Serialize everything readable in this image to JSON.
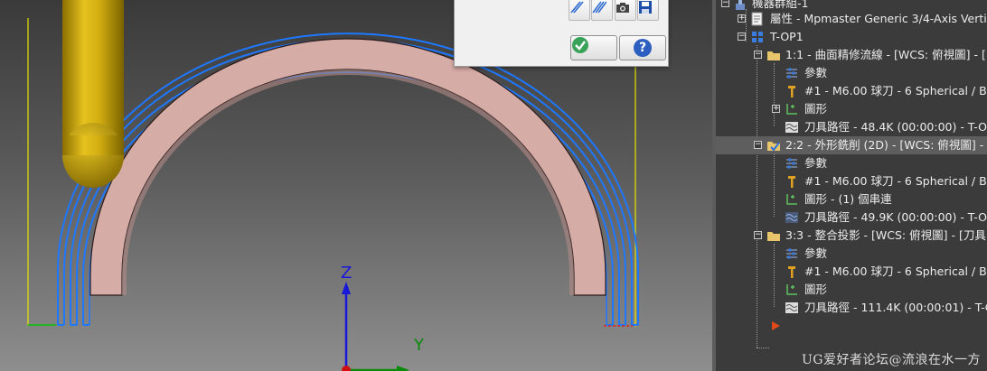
{
  "viewport": {
    "axis_z": "Z",
    "axis_y": "Y"
  },
  "dialog": {
    "buttons": [
      "hatch-icon",
      "hatch-double-icon",
      "camera-icon",
      "save-icon"
    ],
    "ok_icon": "check-icon",
    "help_icon": "help-icon",
    "help_glyph": "?"
  },
  "tree": {
    "machine_group": "機器群組-1",
    "properties": "屬性 - Mpmaster Generic 3/4-Axis Vertic",
    "toolgroup": "T-OP1",
    "ops": [
      {
        "label": "1:1 - 曲面精修流線 - [WCS: 俯視圖] - [",
        "children": [
          "參數",
          "#1 - M6.00 球刀 - 6 Spherical / Ba",
          "圖形",
          "刀具路徑 - 48.4K (00:00:00) - T-O"
        ]
      },
      {
        "label": "2:2 - 外形銑削 (2D) - [WCS: 俯視圖] - [",
        "children": [
          "參數",
          "#1 - M6.00 球刀 - 6 Spherical / Ba",
          "圖形 - (1) 個串連",
          "刀具路徑 - 49.9K (00:00:00) - T-O"
        ]
      },
      {
        "label": "3:3 - 整合投影 - [WCS: 俯視圖] - [刀具",
        "children": [
          "參數",
          "#1 - M6.00 球刀 - 6 Spherical / Ba",
          "圖形",
          "刀具路徑 - 111.4K (00:00:01) - T-C"
        ]
      }
    ]
  },
  "watermark": "UG爱好者论坛@流浪在水一方",
  "colors": {
    "toolpath": "#1e78ff",
    "arch": "#d6aca6",
    "tool": "#c7a40e",
    "tree_bg": "#3b3b3b",
    "selection": "#5e5e5e"
  }
}
